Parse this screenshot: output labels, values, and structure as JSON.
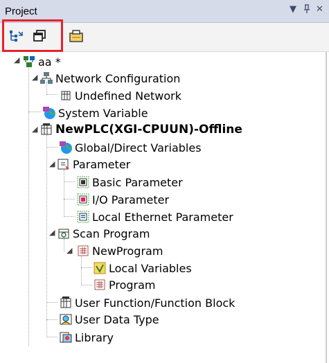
{
  "panel": {
    "title": "Project",
    "dropdown_glyph": "▾",
    "pin_glyph": "ꟷ",
    "close_glyph": "✕"
  },
  "toolbar": {
    "buttons": [
      {
        "name": "tree-view-icon"
      },
      {
        "name": "windows-icon"
      },
      {
        "name": "folder-icon"
      }
    ],
    "highlight_color": "#e8212b"
  },
  "tree": {
    "root": {
      "label": "aa *"
    },
    "network_configuration": {
      "label": "Network Configuration"
    },
    "undefined_network": {
      "label": "Undefined Network"
    },
    "system_variable": {
      "label": "System Variable"
    },
    "plc": {
      "label": "NewPLC(XGI-CPUUN)-Offline"
    },
    "global_direct_variables": {
      "label": "Global/Direct Variables"
    },
    "parameter": {
      "label": "Parameter"
    },
    "basic_parameter": {
      "label": "Basic Parameter"
    },
    "io_parameter": {
      "label": "I/O Parameter"
    },
    "local_ethernet_parameter": {
      "label": "Local Ethernet Parameter"
    },
    "scan_program": {
      "label": "Scan Program"
    },
    "new_program": {
      "label": "NewProgram"
    },
    "local_variables": {
      "label": "Local Variables"
    },
    "program": {
      "label": "Program"
    },
    "user_function_block": {
      "label": "User Function/Function Block"
    },
    "user_data_type": {
      "label": "User Data Type"
    },
    "library": {
      "label": "Library"
    }
  }
}
